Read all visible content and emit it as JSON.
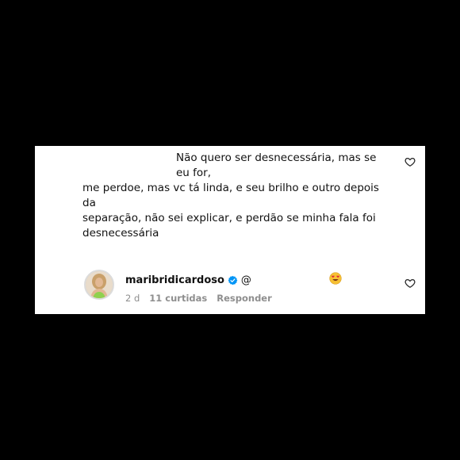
{
  "comment": {
    "lines": [
      "Não quero ser desnecessária, mas se eu for,",
      "me perdoe, mas vc tá linda, e seu brilho e outro depois da",
      "separação, não sei explicar, e perdão se minha fala foi",
      "desnecessária"
    ]
  },
  "reply": {
    "username": "maribridicardoso",
    "mention": "@",
    "time": "2 d",
    "likes": "11 curtidas",
    "reply_label": "Responder"
  },
  "icons": {
    "like": "heart-outline-icon",
    "verified": "verified-badge-icon",
    "emoji": "heart-eyes-emoji-icon"
  },
  "colors": {
    "background": "#000000",
    "card": "#ffffff",
    "text": "#111111",
    "meta": "#8e8e8e",
    "verified": "#0095f6"
  }
}
